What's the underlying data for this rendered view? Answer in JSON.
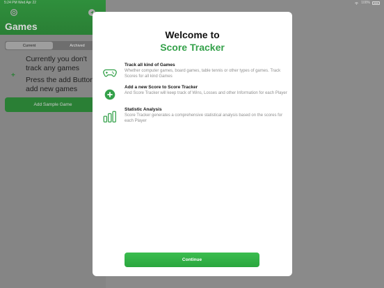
{
  "status_bar": {
    "time_date": "5:24 PM   Wed Apr 22",
    "battery": "100%"
  },
  "sidebar": {
    "title": "Games",
    "segments": [
      "Current",
      "Archived"
    ],
    "active_segment": "Current",
    "empty_line1": "Currently you don't track any games",
    "empty_line2": "Press the add Button to add new games",
    "sample_button": "Add Sample Game"
  },
  "modal": {
    "title_line1": "Welcome to",
    "title_line2": "Score Tracker",
    "features": [
      {
        "icon": "gamepad-icon",
        "title": "Track all kind of Games",
        "description": "Whether computer games, board games, table tennis or other types of games. Track Scores for all kind Games"
      },
      {
        "icon": "plus-circle-icon",
        "title": "Add a new Score to Score Tracker",
        "description": "And Score Tracker will keep track of Wins, Losses and other Information for each Player"
      },
      {
        "icon": "bar-chart-icon",
        "title": "Statistic Analysis",
        "description": "Score Tracker generates a comprehensive statistical analysis based on the scores for each Player"
      }
    ],
    "continue_button": "Continue"
  },
  "colors": {
    "accent": "#34a14a",
    "button": "#2aa63e"
  }
}
